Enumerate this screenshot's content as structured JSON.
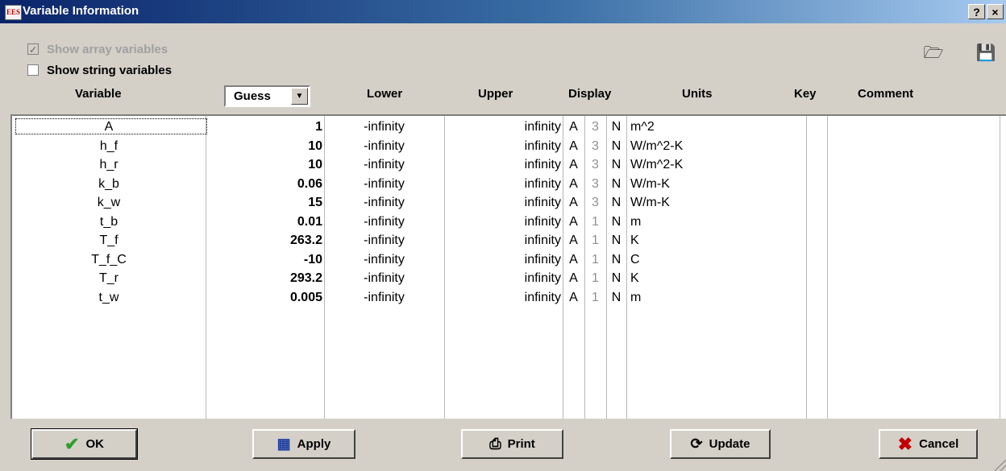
{
  "window": {
    "title": "Variable Information",
    "icon_text": "EES",
    "help_label": "?",
    "close_label": "×"
  },
  "options": {
    "show_array": {
      "label": "Show array variables",
      "checked": true,
      "disabled": true
    },
    "show_string": {
      "label": "Show string variables",
      "checked": false
    }
  },
  "icons": {
    "open": "open-folder-icon",
    "save": "floppy-disk-icon"
  },
  "headers": {
    "variable": "Variable",
    "guess": "Guess",
    "lower": "Lower",
    "upper": "Upper",
    "display": "Display",
    "units": "Units",
    "key": "Key",
    "comment": "Comment"
  },
  "rows": [
    {
      "variable": "A",
      "guess": "1",
      "lower": "-infinity",
      "upper": "infinity",
      "fmt": "A",
      "digits": "3",
      "n": "N",
      "units": "m^2"
    },
    {
      "variable": "h_f",
      "guess": "10",
      "lower": "-infinity",
      "upper": "infinity",
      "fmt": "A",
      "digits": "3",
      "n": "N",
      "units": "W/m^2-K"
    },
    {
      "variable": "h_r",
      "guess": "10",
      "lower": "-infinity",
      "upper": "infinity",
      "fmt": "A",
      "digits": "3",
      "n": "N",
      "units": "W/m^2-K"
    },
    {
      "variable": "k_b",
      "guess": "0.06",
      "lower": "-infinity",
      "upper": "infinity",
      "fmt": "A",
      "digits": "3",
      "n": "N",
      "units": "W/m-K"
    },
    {
      "variable": "k_w",
      "guess": "15",
      "lower": "-infinity",
      "upper": "infinity",
      "fmt": "A",
      "digits": "3",
      "n": "N",
      "units": "W/m-K"
    },
    {
      "variable": "t_b",
      "guess": "0.01",
      "lower": "-infinity",
      "upper": "infinity",
      "fmt": "A",
      "digits": "1",
      "n": "N",
      "units": "m"
    },
    {
      "variable": "T_f",
      "guess": "263.2",
      "lower": "-infinity",
      "upper": "infinity",
      "fmt": "A",
      "digits": "1",
      "n": "N",
      "units": "K"
    },
    {
      "variable": "T_f_C",
      "guess": "-10",
      "lower": "-infinity",
      "upper": "infinity",
      "fmt": "A",
      "digits": "1",
      "n": "N",
      "units": "C"
    },
    {
      "variable": "T_r",
      "guess": "293.2",
      "lower": "-infinity",
      "upper": "infinity",
      "fmt": "A",
      "digits": "1",
      "n": "N",
      "units": "K"
    },
    {
      "variable": "t_w",
      "guess": "0.005",
      "lower": "-infinity",
      "upper": "infinity",
      "fmt": "A",
      "digits": "1",
      "n": "N",
      "units": "m"
    }
  ],
  "buttons": {
    "ok": "OK",
    "apply": "Apply",
    "print": "Print",
    "update": "Update",
    "cancel": "Cancel"
  },
  "colors": {
    "title_start": "#0a246a",
    "title_end": "#a6caf0",
    "face": "#d4d0c8",
    "ok_check": "#2e9e2e",
    "cancel_x": "#c00000"
  }
}
